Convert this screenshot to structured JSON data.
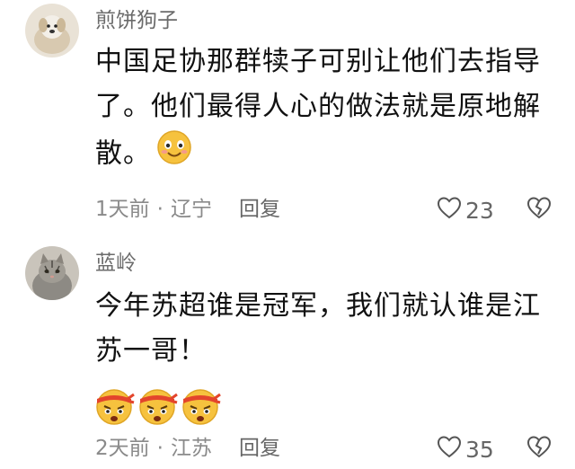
{
  "comments": [
    {
      "username": "煎饼狗子",
      "text": "中国足协那群犊子可别让他们去指导了。他们最得人心的做法就是原地解散。",
      "emoji_icons": [
        "smiling-face-icon"
      ],
      "time": "1天前",
      "location": "辽宁",
      "reply_label": "回复",
      "likes": "23"
    },
    {
      "username": "蓝岭",
      "text": "今年苏超谁是冠军，我们就认谁是江苏一哥！",
      "emoji_icons": [
        "headband-face-icon",
        "headband-face-icon",
        "headband-face-icon"
      ],
      "time": "2天前",
      "location": "江苏",
      "reply_label": "回复",
      "likes": "35"
    }
  ],
  "separator": "·",
  "colors": {
    "username": "#6b6b6b",
    "meta": "#8a8a8a",
    "emoji": "#f6c23e",
    "headband": "#e3452c"
  }
}
